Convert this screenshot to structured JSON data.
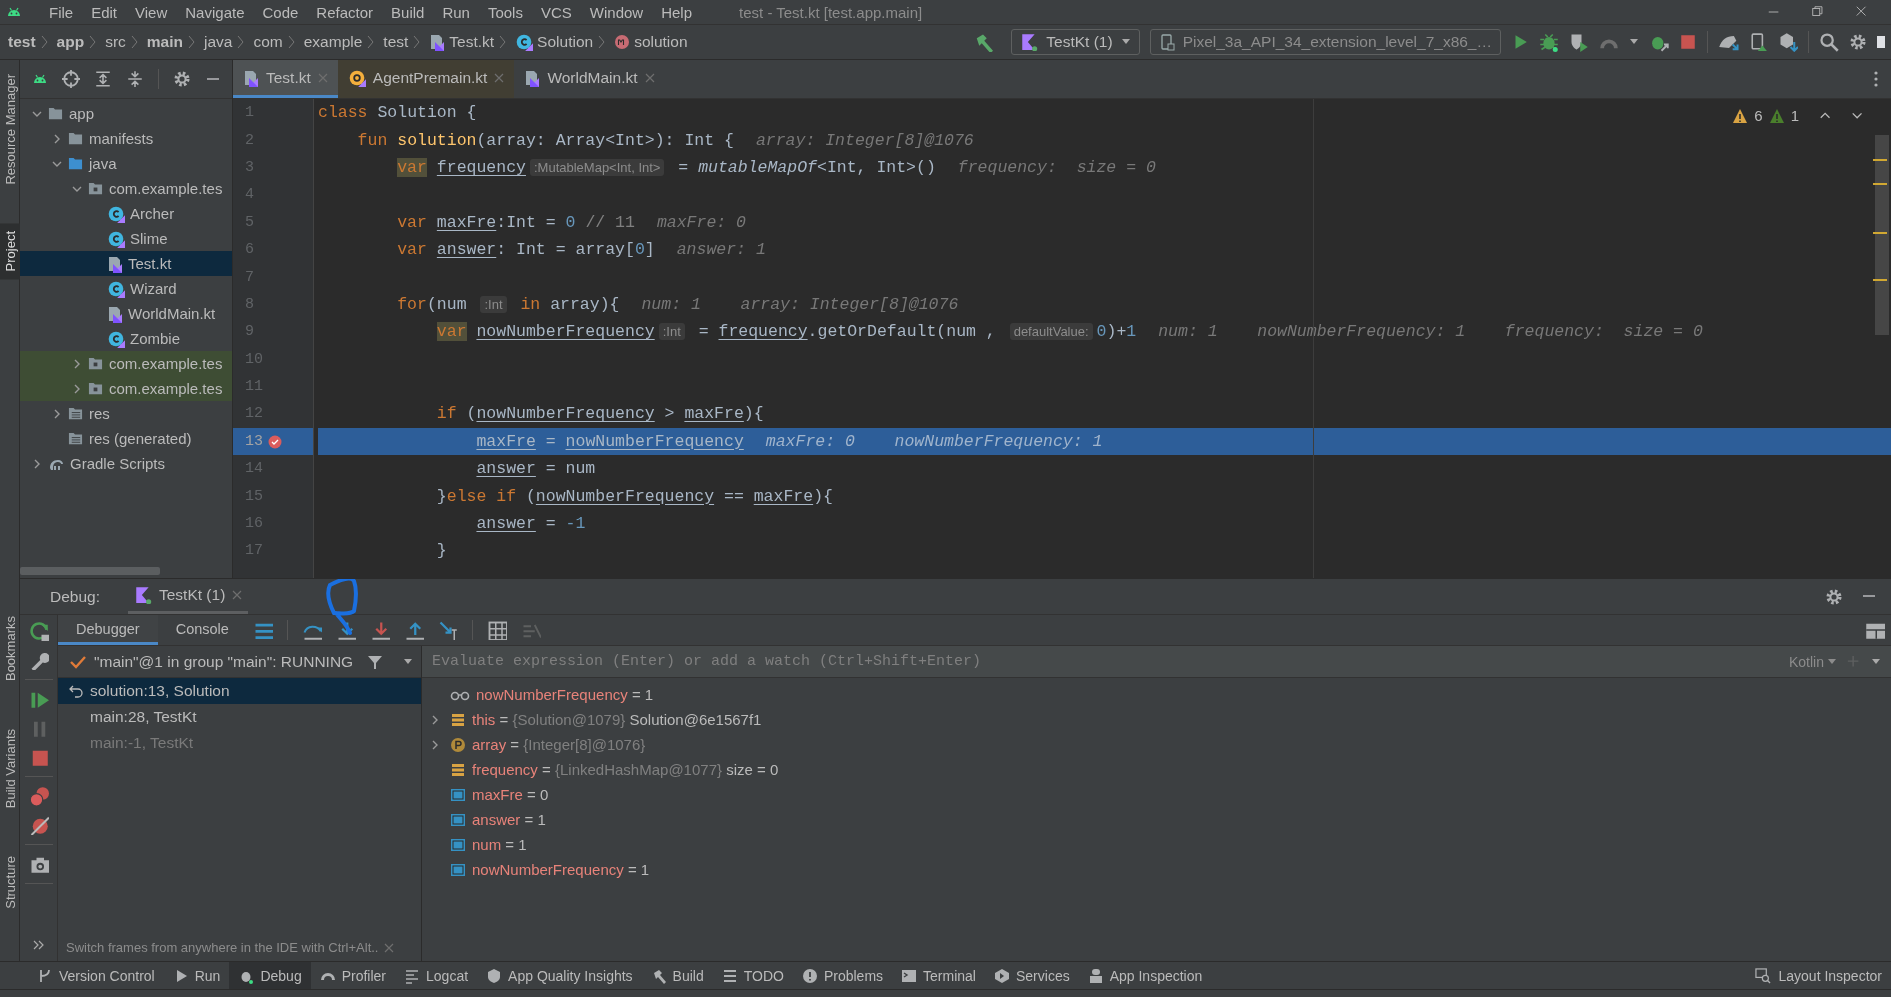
{
  "window": {
    "title": "test - Test.kt [test.app.main]"
  },
  "menu": [
    "File",
    "Edit",
    "View",
    "Navigate",
    "Code",
    "Refactor",
    "Build",
    "Run",
    "Tools",
    "VCS",
    "Window",
    "Help"
  ],
  "breadcrumbs": [
    {
      "label": "test",
      "kind": "module"
    },
    {
      "label": "app",
      "kind": "module"
    },
    {
      "label": "src",
      "kind": "folder"
    },
    {
      "label": "main",
      "kind": "module"
    },
    {
      "label": "java",
      "kind": "folder"
    },
    {
      "label": "com",
      "kind": "folder"
    },
    {
      "label": "example",
      "kind": "folder"
    },
    {
      "label": "test",
      "kind": "folder"
    },
    {
      "label": "Test.kt",
      "kind": "file"
    },
    {
      "label": "Solution",
      "kind": "class"
    },
    {
      "label": "solution",
      "kind": "method"
    }
  ],
  "run_toolbar": {
    "configuration": "TestKt (1)",
    "device": "Pixel_3a_API_34_extension_level_7_x86_…"
  },
  "side_tabs_top": [
    {
      "label": "Resource Manager",
      "selected": false
    },
    {
      "label": "Project",
      "selected": true
    }
  ],
  "side_tabs_bottom": [
    {
      "label": "Bookmarks",
      "selected": false
    },
    {
      "label": "Build Variants",
      "selected": false
    },
    {
      "label": "Structure",
      "selected": false
    }
  ],
  "project_tree": [
    {
      "label": "app",
      "kind": "module",
      "expanded": true,
      "selected": false,
      "highlighted": false,
      "children": [
        {
          "label": "manifests",
          "kind": "folder",
          "expanded": false,
          "selected": false,
          "highlighted": false
        },
        {
          "label": "java",
          "kind": "source",
          "expanded": true,
          "selected": false,
          "highlighted": false,
          "children": [
            {
              "label": "com.example.tes",
              "kind": "package",
              "expanded": true,
              "selected": false,
              "highlighted": false,
              "children": [
                {
                  "label": "Archer",
                  "kind": "class",
                  "selected": false,
                  "highlighted": false
                },
                {
                  "label": "Slime",
                  "kind": "class",
                  "selected": false,
                  "highlighted": false
                },
                {
                  "label": "Test.kt",
                  "kind": "file",
                  "selected": true,
                  "highlighted": false
                },
                {
                  "label": "Wizard",
                  "kind": "class",
                  "selected": false,
                  "highlighted": false
                },
                {
                  "label": "WorldMain.kt",
                  "kind": "file",
                  "selected": false,
                  "highlighted": false
                },
                {
                  "label": "Zombie",
                  "kind": "class",
                  "selected": false,
                  "highlighted": false
                }
              ]
            },
            {
              "label": "com.example.tes",
              "kind": "package",
              "expanded": false,
              "selected": false,
              "highlighted": true
            },
            {
              "label": "com.example.tes",
              "kind": "package",
              "expanded": false,
              "selected": false,
              "highlighted": true
            }
          ]
        },
        {
          "label": "res",
          "kind": "res",
          "expanded": false,
          "selected": false,
          "highlighted": false
        },
        {
          "label": "res (generated)",
          "kind": "res",
          "selected": false,
          "highlighted": false
        }
      ]
    },
    {
      "label": "Gradle Scripts",
      "kind": "gradle",
      "expanded": false,
      "selected": false,
      "highlighted": false
    }
  ],
  "editor": {
    "tabs": [
      {
        "label": "Test.kt",
        "kind": "file",
        "selected": true
      },
      {
        "label": "AgentPremain.kt",
        "kind": "agent",
        "selected": false
      },
      {
        "label": "WorldMain.kt",
        "kind": "file",
        "selected": false
      }
    ],
    "warnings": "6",
    "weak_warnings": "1",
    "lines": [
      {
        "number": "1",
        "breakpoint": false,
        "current": false,
        "segments": [
          {
            "kind": "kw",
            "text": "class"
          },
          {
            "kind": "plain",
            "text": " Solution {"
          }
        ]
      },
      {
        "number": "2",
        "breakpoint": false,
        "current": false,
        "segments": [
          {
            "kind": "kw",
            "text": "    fun"
          },
          {
            "kind": "fn",
            "text": " solution"
          },
          {
            "kind": "plain",
            "text": "(array: Array<Int>): Int {"
          },
          {
            "kind": "debug",
            "text": "array: Integer[8]@1076"
          }
        ]
      },
      {
        "number": "3",
        "breakpoint": false,
        "current": false,
        "segments": [
          {
            "kind": "kw-warn",
            "text": "        var"
          },
          {
            "kind": "var",
            "text": " frequency"
          },
          {
            "kind": "hint",
            "text": ":MutableMap<Int, Int>"
          },
          {
            "kind": "plain",
            "text": " = "
          },
          {
            "kind": "call",
            "text": "mutableMapOf"
          },
          {
            "kind": "plain",
            "text": "<Int, Int>()"
          },
          {
            "kind": "debug",
            "text": "frequency:  size = 0"
          }
        ]
      },
      {
        "number": "4",
        "breakpoint": false,
        "current": false
      },
      {
        "number": "5",
        "breakpoint": false,
        "current": false,
        "segments": [
          {
            "kind": "kw",
            "text": "        var"
          },
          {
            "kind": "var",
            "text": " maxFre"
          },
          {
            "kind": "plain",
            "text": ":Int = "
          },
          {
            "kind": "num",
            "text": "0"
          },
          {
            "kind": "comment",
            "text": " // 11"
          },
          {
            "kind": "debug",
            "text": "maxFre: 0"
          }
        ]
      },
      {
        "number": "6",
        "breakpoint": false,
        "current": false,
        "segments": [
          {
            "kind": "kw",
            "text": "        var"
          },
          {
            "kind": "var",
            "text": " answer"
          },
          {
            "kind": "plain",
            "text": ": Int = array["
          },
          {
            "kind": "num",
            "text": "0"
          },
          {
            "kind": "plain",
            "text": "]"
          },
          {
            "kind": "debug",
            "text": "answer: 1"
          }
        ]
      },
      {
        "number": "7",
        "breakpoint": false,
        "current": false
      },
      {
        "number": "8",
        "breakpoint": false,
        "current": false,
        "segments": [
          {
            "kind": "kw",
            "text": "        for"
          },
          {
            "kind": "plain",
            "text": "(num "
          },
          {
            "kind": "hint",
            "text": ":Int"
          },
          {
            "kind": "kw",
            "text": " in"
          },
          {
            "kind": "plain",
            "text": " array){"
          },
          {
            "kind": "debug",
            "text": "num: 1    array: Integer[8]@1076"
          }
        ]
      },
      {
        "number": "9",
        "breakpoint": false,
        "current": false,
        "segments": [
          {
            "kind": "kw-warn",
            "text": "            var"
          },
          {
            "kind": "var",
            "text": " nowNumberFrequency"
          },
          {
            "kind": "hint",
            "text": ":Int"
          },
          {
            "kind": "plain",
            "text": " = "
          },
          {
            "kind": "var",
            "text": "frequency"
          },
          {
            "kind": "plain",
            "text": ".getOrDefault(num , "
          },
          {
            "kind": "hint",
            "text": "defaultValue:"
          },
          {
            "kind": "num",
            "text": "0"
          },
          {
            "kind": "plain",
            "text": ")+"
          },
          {
            "kind": "num",
            "text": "1"
          },
          {
            "kind": "debug",
            "text": "num: 1    nowNumberFrequency: 1    frequency:  size = 0"
          }
        ]
      },
      {
        "number": "10",
        "breakpoint": false,
        "current": false
      },
      {
        "number": "11",
        "breakpoint": false,
        "current": false
      },
      {
        "number": "12",
        "breakpoint": false,
        "current": false,
        "segments": [
          {
            "kind": "kw",
            "text": "            if"
          },
          {
            "kind": "plain",
            "text": " ("
          },
          {
            "kind": "var",
            "text": "nowNumberFrequency"
          },
          {
            "kind": "plain",
            "text": " > "
          },
          {
            "kind": "var",
            "text": "maxFre"
          },
          {
            "kind": "plain",
            "text": "){"
          }
        ]
      },
      {
        "number": "13",
        "breakpoint": true,
        "current": true,
        "segments": [
          {
            "kind": "var",
            "text": "                maxFre"
          },
          {
            "kind": "plain",
            "text": " = "
          },
          {
            "kind": "var",
            "text": "nowNumberFrequency"
          },
          {
            "kind": "debug",
            "text": "maxFre: 0    nowNumberFrequency: 1"
          }
        ]
      },
      {
        "number": "14",
        "breakpoint": false,
        "current": false,
        "segments": [
          {
            "kind": "var",
            "text": "                answer"
          },
          {
            "kind": "plain",
            "text": " = num"
          }
        ]
      },
      {
        "number": "15",
        "breakpoint": false,
        "current": false,
        "segments": [
          {
            "kind": "plain",
            "text": "            }"
          },
          {
            "kind": "kw",
            "text": "else if"
          },
          {
            "kind": "plain",
            "text": " ("
          },
          {
            "kind": "var",
            "text": "nowNumberFrequency"
          },
          {
            "kind": "plain",
            "text": " == "
          },
          {
            "kind": "var",
            "text": "maxFre"
          },
          {
            "kind": "plain",
            "text": "){"
          }
        ]
      },
      {
        "number": "16",
        "breakpoint": false,
        "current": false,
        "segments": [
          {
            "kind": "var",
            "text": "                answer"
          },
          {
            "kind": "plain",
            "text": " = "
          },
          {
            "kind": "num",
            "text": "-1"
          }
        ]
      },
      {
        "number": "17",
        "breakpoint": false,
        "current": false,
        "segments": [
          {
            "kind": "plain",
            "text": "            }"
          }
        ]
      }
    ]
  },
  "debug": {
    "label": "Debug:",
    "session": "TestKt (1)",
    "tabs": [
      {
        "label": "Debugger",
        "selected": true
      },
      {
        "label": "Console",
        "selected": false
      }
    ],
    "thread": "\"main\"@1 in group \"main\": RUNNING",
    "frames": [
      {
        "label": "solution:13, Solution",
        "selected": true,
        "disabled": false
      },
      {
        "label": "main:28, TestKt",
        "selected": false,
        "disabled": false
      },
      {
        "label": "main:-1, TestKt",
        "selected": false,
        "disabled": true
      }
    ],
    "hint": "Switch frames from anywhere in the IDE with Ctrl+Alt..",
    "evaluate_placeholder": "Evaluate expression (Enter) or add a watch (Ctrl+Shift+Enter)",
    "language": "Kotlin",
    "variables": [
      {
        "kind": "watch",
        "name": "nowNumberFrequency",
        "operator": "=",
        "value": "1"
      },
      {
        "kind": "field",
        "name": "this",
        "operator": "=",
        "ref": "{Solution@1079}",
        "value": "Solution@6e1567f1",
        "expanded": false
      },
      {
        "kind": "param",
        "name": "array",
        "operator": "=",
        "ref": "{Integer[8]@1076}",
        "expanded": false
      },
      {
        "kind": "field",
        "name": "frequency",
        "operator": "=",
        "ref": "{LinkedHashMap@1077}",
        "value": "size = 0"
      },
      {
        "kind": "local",
        "name": "maxFre",
        "operator": "=",
        "value": "0"
      },
      {
        "kind": "local",
        "name": "answer",
        "operator": "=",
        "value": "1"
      },
      {
        "kind": "local",
        "name": "num",
        "operator": "=",
        "value": "1"
      },
      {
        "kind": "local",
        "name": "nowNumberFrequency",
        "operator": "=",
        "value": "1"
      }
    ]
  },
  "tool_windows": [
    {
      "label": "Version Control",
      "selected": false
    },
    {
      "label": "Run",
      "selected": false
    },
    {
      "label": "Debug",
      "selected": true
    },
    {
      "label": "Profiler",
      "selected": false
    },
    {
      "label": "Logcat",
      "selected": false
    },
    {
      "label": "App Quality Insights",
      "selected": false
    },
    {
      "label": "Build",
      "selected": false
    },
    {
      "label": "TODO",
      "selected": false
    },
    {
      "label": "Problems",
      "selected": false
    },
    {
      "label": "Terminal",
      "selected": false
    },
    {
      "label": "Services",
      "selected": false
    },
    {
      "label": "App Inspection",
      "selected": false
    }
  ],
  "tool_windows_right": [
    {
      "label": "Layout Inspector",
      "selected": false
    }
  ]
}
